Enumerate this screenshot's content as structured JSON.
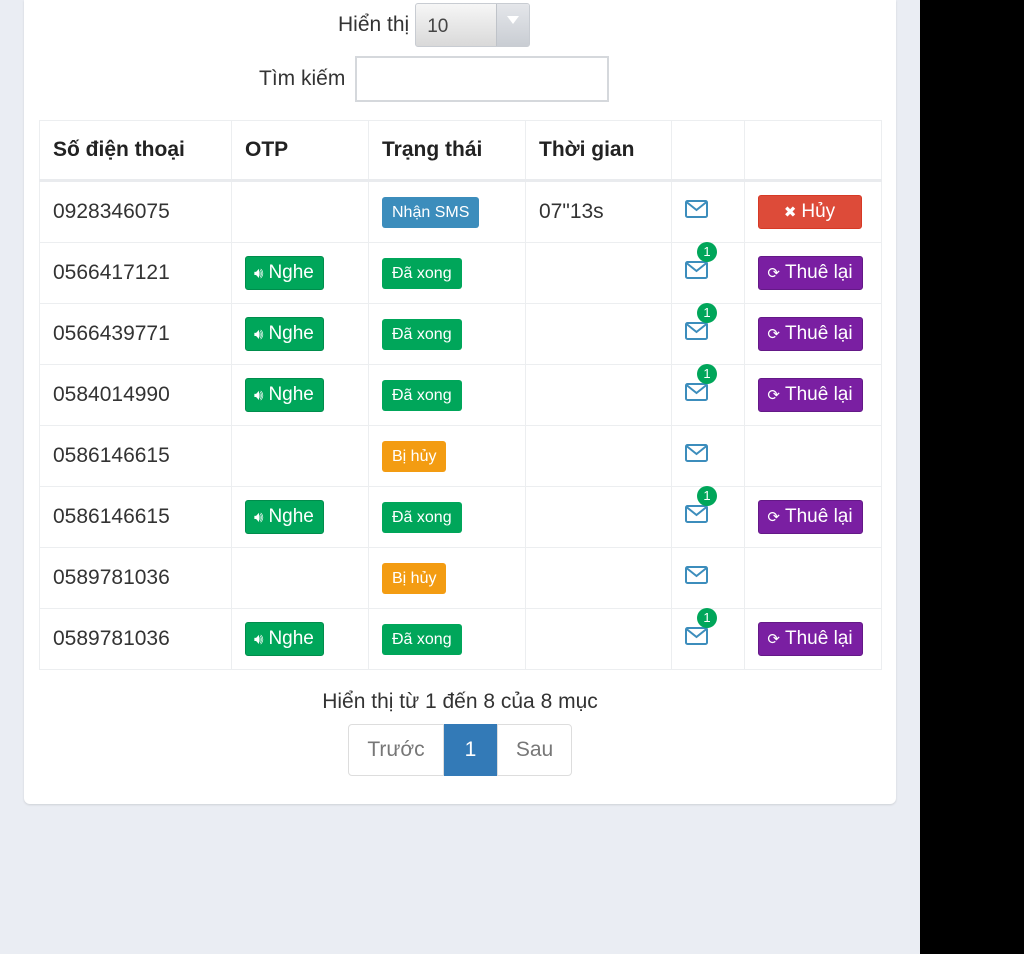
{
  "length": {
    "label": "Hiển thị",
    "value": "10"
  },
  "search": {
    "label": "Tìm kiếm",
    "value": ""
  },
  "table": {
    "headers": [
      "Số điện thoại",
      "OTP",
      "Trạng thái",
      "Thời gian",
      "",
      ""
    ],
    "rows": [
      {
        "phone": "0928346075",
        "otp": "",
        "status": "Nhận SMS",
        "status_color": "#3c8dbc",
        "time": "07\"13s",
        "mail_count": "",
        "action": "Hủy",
        "action_color": "#dd4b39"
      },
      {
        "phone": "0566417121",
        "otp": "Nghe",
        "status": "Đã xong",
        "status_color": "#00a65a",
        "time": "",
        "mail_count": "1",
        "action": "Thuê lại",
        "action_color": "#7a1fa2"
      },
      {
        "phone": "0566439771",
        "otp": "Nghe",
        "status": "Đã xong",
        "status_color": "#00a65a",
        "time": "",
        "mail_count": "1",
        "action": "Thuê lại",
        "action_color": "#7a1fa2"
      },
      {
        "phone": "0584014990",
        "otp": "Nghe",
        "status": "Đã xong",
        "status_color": "#00a65a",
        "time": "",
        "mail_count": "1",
        "action": "Thuê lại",
        "action_color": "#7a1fa2"
      },
      {
        "phone": "0586146615",
        "otp": "",
        "status": "Bị hủy",
        "status_color": "#f39c12",
        "time": "",
        "mail_count": "",
        "action": "",
        "action_color": ""
      },
      {
        "phone": "0586146615",
        "otp": "Nghe",
        "status": "Đã xong",
        "status_color": "#00a65a",
        "time": "",
        "mail_count": "1",
        "action": "Thuê lại",
        "action_color": "#7a1fa2"
      },
      {
        "phone": "0589781036",
        "otp": "",
        "status": "Bị hủy",
        "status_color": "#f39c12",
        "time": "",
        "mail_count": "",
        "action": "",
        "action_color": ""
      },
      {
        "phone": "0589781036",
        "otp": "Nghe",
        "status": "Đã xong",
        "status_color": "#00a65a",
        "time": "",
        "mail_count": "1",
        "action": "Thuê lại",
        "action_color": "#7a1fa2"
      }
    ]
  },
  "info": "Hiển thị từ 1 đến 8 của 8 mục",
  "pagination": {
    "prev": "Trước",
    "current": "1",
    "next": "Sau"
  },
  "icons": {
    "otp_icon": "volume-icon",
    "mail_icon": "envelope-icon",
    "cancel_icon": "times-icon",
    "rent_icon": "refresh-icon"
  },
  "colors": {
    "primary": "#337ab7",
    "green": "#00a65a",
    "orange": "#f39c12",
    "red": "#dd4b39",
    "purple": "#7a1fa2",
    "mail": "#3c8dbc"
  }
}
